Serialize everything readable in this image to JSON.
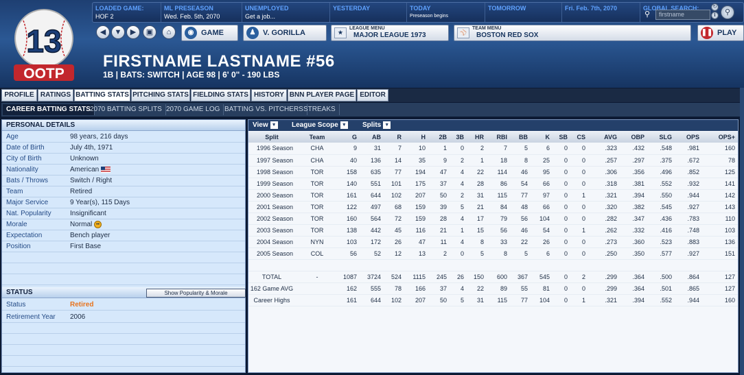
{
  "infobar": {
    "loaded_game_label": "LOADED GAME:",
    "loaded_game_value": "HOF 2",
    "preseason_label": "ML PRESEASON",
    "preseason_value": "Wed. Feb. 5th, 2070",
    "status_label": "UNEMPLOYED",
    "status_value": "Get a job...",
    "yesterday_label": "YESTERDAY",
    "today_label": "TODAY",
    "today_value": "Preseason begins",
    "tomorrow_label": "TOMORROW",
    "future_label": "Fri. Feb. 7th, 2070",
    "search_label": "GLOBAL SEARCH:",
    "search_value": "firstname"
  },
  "logo": {
    "number": "13",
    "text": "OOTP"
  },
  "nav": {
    "game_label": "GAME",
    "manager_label": "V. GORILLA",
    "league_menu_header": "LEAGUE MENU",
    "league_menu_value": "MAJOR LEAGUE 1973",
    "team_menu_header": "TEAM MENU",
    "team_menu_value": "BOSTON RED SOX",
    "play_label": "PLAY"
  },
  "player": {
    "name": "FIRSTNAME LASTNAME  #56",
    "subtitle": "1B | BATS: SWITCH | AGE 98 | 6' 0\" - 190 LBS"
  },
  "tabs": [
    "PROFILE",
    "RATINGS",
    "BATTING STATS",
    "PITCHING STATS",
    "FIELDING STATS",
    "HISTORY",
    "BNN PLAYER PAGE",
    "EDITOR"
  ],
  "subtabs": [
    "CAREER BATTING STATS",
    "2070 BATTING SPLITS",
    "2070 GAME LOG",
    "BATTING VS. PITCHERS",
    "STREAKS"
  ],
  "personal": {
    "header": "PERSONAL DETAILS",
    "rows": [
      {
        "k": "Age",
        "v": "98 years, 216 days"
      },
      {
        "k": "Date of Birth",
        "v": "July 4th, 1971"
      },
      {
        "k": "City of Birth",
        "v": "Unknown"
      },
      {
        "k": "Nationality",
        "v": "American"
      },
      {
        "k": "Bats / Throws",
        "v": "Switch / Right"
      },
      {
        "k": "Team",
        "v": "Retired"
      },
      {
        "k": "Major Service",
        "v": "9 Year(s), 115 Days"
      },
      {
        "k": "Nat. Popularity",
        "v": "Insignificant"
      },
      {
        "k": "Morale",
        "v": "Normal"
      },
      {
        "k": "Expectation",
        "v": "Bench player"
      },
      {
        "k": "Position",
        "v": "First Base"
      }
    ]
  },
  "status": {
    "header": "STATUS",
    "button": "Show Popularity & Morale",
    "status_label": "Status",
    "status_value": "Retired",
    "status_color": "#e8731c",
    "retire_label": "Retirement Year",
    "retire_value": "2006"
  },
  "toolbar": {
    "view": "View",
    "scope": "League Scope",
    "splits": "Splits"
  },
  "stats": {
    "headers": [
      "Split",
      "Team",
      "G",
      "AB",
      "R",
      "H",
      "2B",
      "3B",
      "HR",
      "RBI",
      "BB",
      "K",
      "SB",
      "CS",
      "AVG",
      "OBP",
      "SLG",
      "OPS",
      "OPS+"
    ],
    "rows": [
      [
        "1996 Season",
        "CHA",
        "9",
        "31",
        "7",
        "10",
        "1",
        "0",
        "2",
        "7",
        "5",
        "6",
        "0",
        "0",
        ".323",
        ".432",
        ".548",
        ".981",
        "160"
      ],
      [
        "1997 Season",
        "CHA",
        "40",
        "136",
        "14",
        "35",
        "9",
        "2",
        "1",
        "18",
        "8",
        "25",
        "0",
        "0",
        ".257",
        ".297",
        ".375",
        ".672",
        "78"
      ],
      [
        "1998 Season",
        "TOR",
        "158",
        "635",
        "77",
        "194",
        "47",
        "4",
        "22",
        "114",
        "46",
        "95",
        "0",
        "0",
        ".306",
        ".356",
        ".496",
        ".852",
        "125"
      ],
      [
        "1999 Season",
        "TOR",
        "140",
        "551",
        "101",
        "175",
        "37",
        "4",
        "28",
        "86",
        "54",
        "66",
        "0",
        "0",
        ".318",
        ".381",
        ".552",
        ".932",
        "141"
      ],
      [
        "2000 Season",
        "TOR",
        "161",
        "644",
        "102",
        "207",
        "50",
        "2",
        "31",
        "115",
        "77",
        "97",
        "0",
        "1",
        ".321",
        ".394",
        ".550",
        ".944",
        "142"
      ],
      [
        "2001 Season",
        "TOR",
        "122",
        "497",
        "68",
        "159",
        "39",
        "5",
        "21",
        "84",
        "48",
        "66",
        "0",
        "0",
        ".320",
        ".382",
        ".545",
        ".927",
        "143"
      ],
      [
        "2002 Season",
        "TOR",
        "160",
        "564",
        "72",
        "159",
        "28",
        "4",
        "17",
        "79",
        "56",
        "104",
        "0",
        "0",
        ".282",
        ".347",
        ".436",
        ".783",
        "110"
      ],
      [
        "2003 Season",
        "TOR",
        "138",
        "442",
        "45",
        "116",
        "21",
        "1",
        "15",
        "56",
        "46",
        "54",
        "0",
        "1",
        ".262",
        ".332",
        ".416",
        ".748",
        "103"
      ],
      [
        "2004 Season",
        "NYN",
        "103",
        "172",
        "26",
        "47",
        "11",
        "4",
        "8",
        "33",
        "22",
        "26",
        "0",
        "0",
        ".273",
        ".360",
        ".523",
        ".883",
        "136"
      ],
      [
        "2005 Season",
        "COL",
        "56",
        "52",
        "12",
        "13",
        "2",
        "0",
        "5",
        "8",
        "5",
        "6",
        "0",
        "0",
        ".250",
        ".350",
        ".577",
        ".927",
        "151"
      ]
    ],
    "totals": [
      [
        "TOTAL",
        "-",
        "1087",
        "3724",
        "524",
        "1115",
        "245",
        "26",
        "150",
        "600",
        "367",
        "545",
        "0",
        "2",
        ".299",
        ".364",
        ".500",
        ".864",
        "127"
      ],
      [
        "162 Game AVG",
        "",
        "162",
        "555",
        "78",
        "166",
        "37",
        "4",
        "22",
        "89",
        "55",
        "81",
        "0",
        "0",
        ".299",
        ".364",
        ".501",
        ".865",
        "127"
      ],
      [
        "Career Highs",
        "",
        "161",
        "644",
        "102",
        "207",
        "50",
        "5",
        "31",
        "115",
        "77",
        "104",
        "0",
        "1",
        ".321",
        ".394",
        ".552",
        ".944",
        "160"
      ]
    ]
  }
}
